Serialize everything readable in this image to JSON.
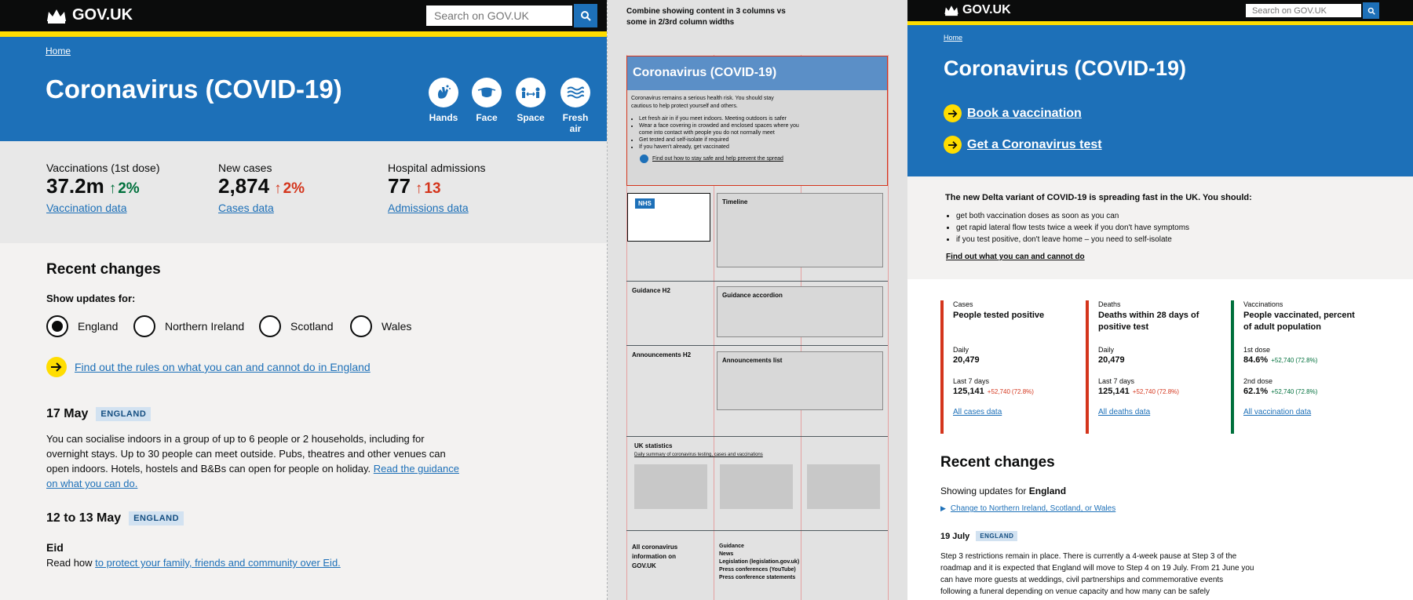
{
  "brand": "GOV.UK",
  "search_placeholder": "Search on GOV.UK",
  "breadcrumb": "Home",
  "title": "Coronavirus (COVID-19)",
  "pills": [
    "Hands",
    "Face",
    "Space",
    "Fresh air"
  ],
  "stats": [
    {
      "label": "Vaccinations (1st dose)",
      "value": "37.2m",
      "change": "2%",
      "link": "Vaccination data",
      "color": "#00703c"
    },
    {
      "label": "New cases",
      "value": "2,874",
      "change": "2%",
      "link": "Cases data",
      "color": "#d4351c"
    },
    {
      "label": "Hospital admissions",
      "value": "77",
      "change": "13",
      "link": "Admissions data",
      "color": "#d4351c"
    }
  ],
  "recent": {
    "heading": "Recent changes",
    "show_for": "Show updates for:",
    "radios": [
      "England",
      "Northern Ireland",
      "Scotland",
      "Wales"
    ],
    "rules_link": "Find out the rules on what you can and cannot do in England",
    "item1": {
      "date": "17 May",
      "tag": "ENGLAND",
      "text": "You can socialise indoors in a group of up to 6 people or 2 households, including for overnight stays. Up to 30 people can meet outside. Pubs, theatres and other venues can open indoors. Hotels, hostels and B&Bs can open for people on holiday.",
      "link": "Read the guidance on what you can do."
    },
    "item2": {
      "date": "12 to 13 May",
      "tag": "ENGLAND",
      "sub": "Eid",
      "pre": "Read how",
      "link": "to protect your family, friends and community over Eid."
    }
  },
  "wireframe": {
    "note": "Combine showing content in 3 columns vs some in 2/3rd column widths",
    "title": "Coronavirus (COVID-19)",
    "intro": "Coronavirus remains a serious health risk. You should stay cautious to help protect yourself and others.",
    "bullets": [
      "Let fresh air in if you meet indoors. Meeting outdoors is safer",
      "Wear a face covering in crowded and enclosed spaces where you come into contact with people you do not normally meet",
      "Get tested and self-isolate if required",
      "If you haven't already, get vaccinated"
    ],
    "link": "Find out how to stay safe and help prevent the spread",
    "nhs": "NHS",
    "timeline": "Timeline",
    "guidance_h2": "Guidance H2",
    "guidance_acc": "Guidance accordion",
    "ann_h2": "Announcements H2",
    "ann_list": "Announcements list",
    "uk_stats": "UK statistics",
    "uk_stats_sub": "Daily summary of coronavirus testing, cases and vaccinations",
    "all_info": "All coronavirus information on GOV.UK",
    "links": [
      "Guidance",
      "News",
      "Legislation (legislation.gov.uk)",
      "Press conferences (YouTube)",
      "Press conference statements"
    ]
  },
  "right": {
    "actions": [
      "Book a vaccination",
      "Get a Coronavirus test"
    ],
    "delta": "The new Delta variant of COVID-19 is spreading fast in the UK. You should:",
    "delta_items": [
      "get both vaccination doses as soon as you can",
      "get rapid lateral flow tests twice a week if you don't have symptoms",
      "if you test positive, don't leave home – you need to self-isolate"
    ],
    "delta_link": "Find out what you can and cannot do",
    "cards": [
      {
        "kicker": "Cases",
        "title": "People tested positive",
        "l1": "Daily",
        "v1": "20,479",
        "l2": "Last 7 days",
        "v2": "125,141",
        "d2": "+52,740",
        "p2": "(72.8%)",
        "link": "All cases data",
        "color": "#d4351c"
      },
      {
        "kicker": "Deaths",
        "title": "Deaths within 28 days of positive test",
        "l1": "Daily",
        "v1": "20,479",
        "l2": "Last 7 days",
        "v2": "125,141",
        "d2": "+52,740",
        "p2": "(72.8%)",
        "link": "All deaths data",
        "color": "#d4351c"
      },
      {
        "kicker": "Vaccinations",
        "title": "People vaccinated, percent of adult population",
        "l1": "1st dose",
        "v1": "84.6%",
        "d1": "+52,740",
        "p1": "(72.8%)",
        "l2": "2nd dose",
        "v2": "62.1%",
        "d2": "+52,740",
        "p2": "(72.8%)",
        "link": "All vaccination data",
        "color": "#00703c"
      }
    ],
    "recent_heading": "Recent changes",
    "showing": "Showing updates for",
    "showing_bold": "England",
    "change_link": "Change to Northern Ireland, Scotland, or Wales",
    "date": "19 July",
    "tag": "ENGLAND",
    "text": "Step 3 restrictions remain in place. There is currently a 4-week pause at Step 3 of the roadmap and it is expected that England will move to Step 4 on 19 July. From 21 June you can have more guests at weddings, civil partnerships and commemorative events following a funeral depending on venue capacity and how many can be safely"
  }
}
